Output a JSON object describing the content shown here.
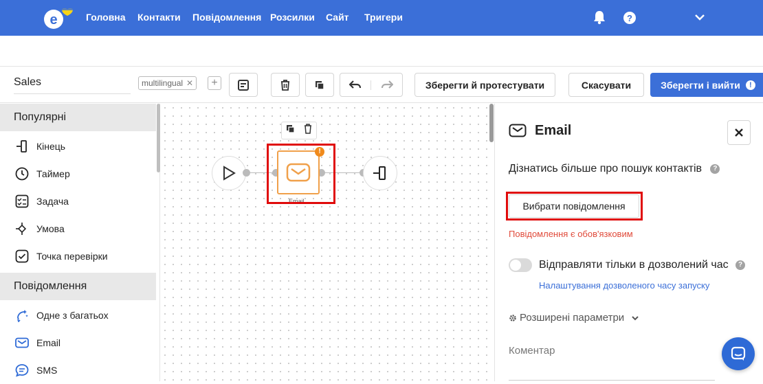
{
  "nav": {
    "items": [
      "Головна",
      "Контакти",
      "Повідомлення",
      "Розсилки",
      "Сайт",
      "Тригери"
    ]
  },
  "toolbar": {
    "flow_name": "Sales",
    "tag": "multilingual",
    "save_test_label": "Зберегти й протестувати",
    "cancel_label": "Скасувати",
    "save_exit_label": "Зберегти і вийти"
  },
  "sidebar": {
    "sections": [
      {
        "title": "Популярні",
        "items": [
          {
            "label": "Кінець",
            "icon": "end-icon"
          },
          {
            "label": "Таймер",
            "icon": "timer-icon"
          },
          {
            "label": "Задача",
            "icon": "task-icon"
          },
          {
            "label": "Умова",
            "icon": "condition-icon"
          },
          {
            "label": "Точка перевірки",
            "icon": "checkpoint-icon"
          }
        ]
      },
      {
        "title": "Повідомлення",
        "items": [
          {
            "label": "Одне з багатьох",
            "icon": "sparkle-icon"
          },
          {
            "label": "Email",
            "icon": "envelope-icon"
          },
          {
            "label": "SMS",
            "icon": "sms-icon"
          }
        ]
      }
    ]
  },
  "canvas": {
    "email_node_label": "Email"
  },
  "panel": {
    "title": "Email",
    "learn_more": "Дізнатись більше про пошук контактів",
    "choose_message": "Вибрати повідомлення",
    "required_message": "Повідомлення є обов'язковим",
    "toggle_label": "Відправляти тільки в дозволений час",
    "time_link": "Налаштування дозволеного часу запуску",
    "advanced": "Розширені параметри",
    "comment_label": "Коментар"
  },
  "colors": {
    "brand": "#3b6fd8",
    "highlight": "#e00a0a",
    "node_orange": "#f0a04a",
    "error": "#e04a3a"
  }
}
